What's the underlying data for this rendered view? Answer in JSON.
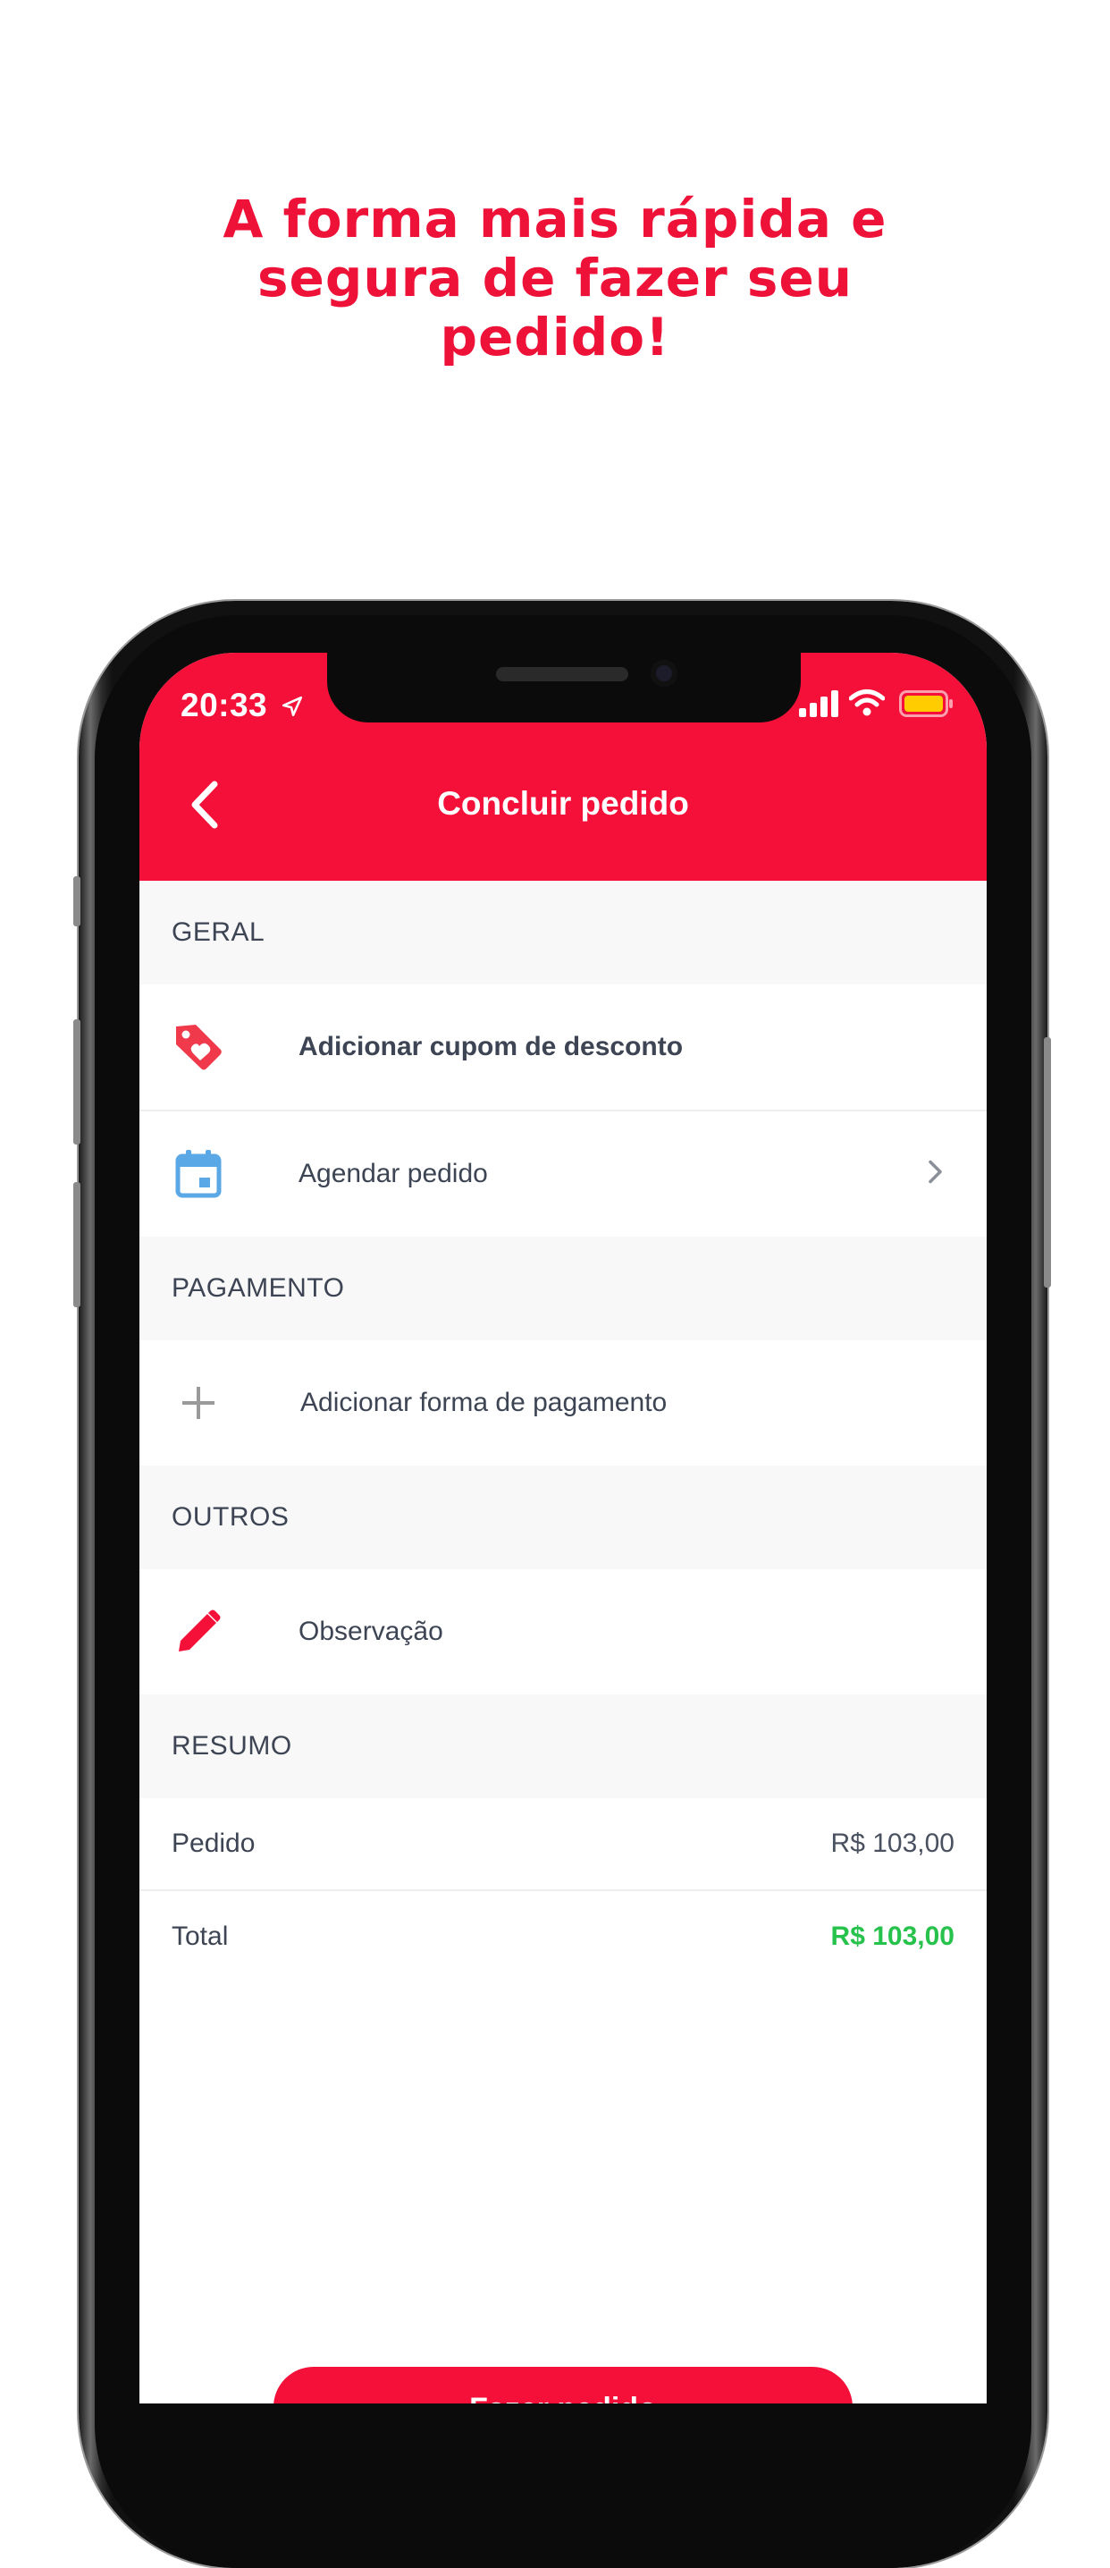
{
  "headline": {
    "line1": "A forma mais rápida e",
    "line2": "segura de fazer seu",
    "line3": "pedido!"
  },
  "status_bar": {
    "time": "20:33",
    "icons": [
      "location-arrow-icon",
      "signal-icon",
      "wifi-icon",
      "battery-icon"
    ]
  },
  "appbar": {
    "title": "Concluir pedido",
    "back_icon": "chevron-left-icon"
  },
  "sections": {
    "geral": {
      "title": "GERAL",
      "coupon_label": "Adicionar cupom de desconto",
      "schedule_label": "Agendar pedido"
    },
    "pagamento": {
      "title": "PAGAMENTO",
      "add_payment_label": "Adicionar forma de pagamento"
    },
    "outros": {
      "title": "OUTROS",
      "note_label": "Observação"
    },
    "resumo": {
      "title": "RESUMO",
      "order_label": "Pedido",
      "order_value": "R$ 103,00",
      "total_label": "Total",
      "total_value": "R$ 103,00"
    }
  },
  "cta": {
    "label": "Fazer pedido"
  },
  "colors": {
    "brand": "#F41038",
    "headline": "#EE1238",
    "total": "#27C24C",
    "calendar": "#5AA9E6"
  }
}
